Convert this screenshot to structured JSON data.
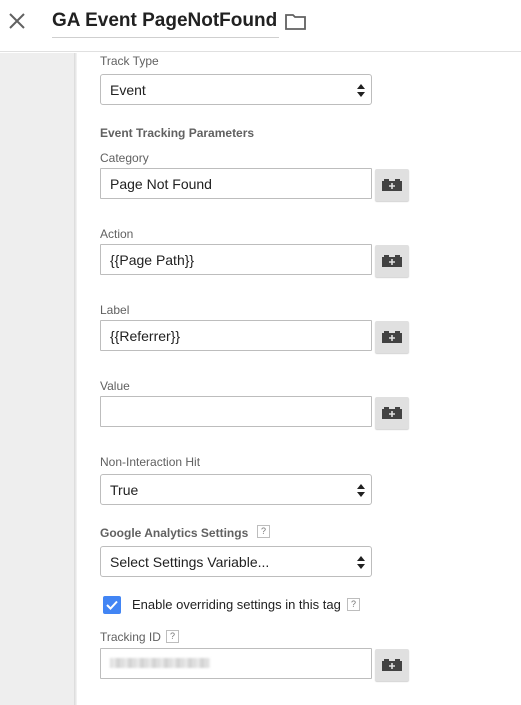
{
  "header": {
    "title": "GA Event PageNotFound",
    "close_icon": "close-icon",
    "folder_icon": "folder-icon"
  },
  "form": {
    "track_type": {
      "label": "Track Type",
      "value": "Event"
    },
    "event_params_heading": "Event Tracking Parameters",
    "category": {
      "label": "Category",
      "value": "Page Not Found"
    },
    "action": {
      "label": "Action",
      "value": "{{Page Path}}"
    },
    "label_field": {
      "label": "Label",
      "value": "{{Referrer}}"
    },
    "value_field": {
      "label": "Value",
      "value": ""
    },
    "non_interaction": {
      "label": "Non-Interaction Hit",
      "value": "True"
    },
    "ga_settings": {
      "label": "Google Analytics Settings",
      "help": "?",
      "value": "Select Settings Variable..."
    },
    "override": {
      "label": "Enable overriding settings in this tag",
      "help": "?",
      "checked": true
    },
    "tracking_id": {
      "label": "Tracking ID",
      "help": "?",
      "value": ""
    }
  },
  "colors": {
    "accent": "#4285f4",
    "gutter": "#eeeeee",
    "variable_button": "#e0e0e0"
  }
}
